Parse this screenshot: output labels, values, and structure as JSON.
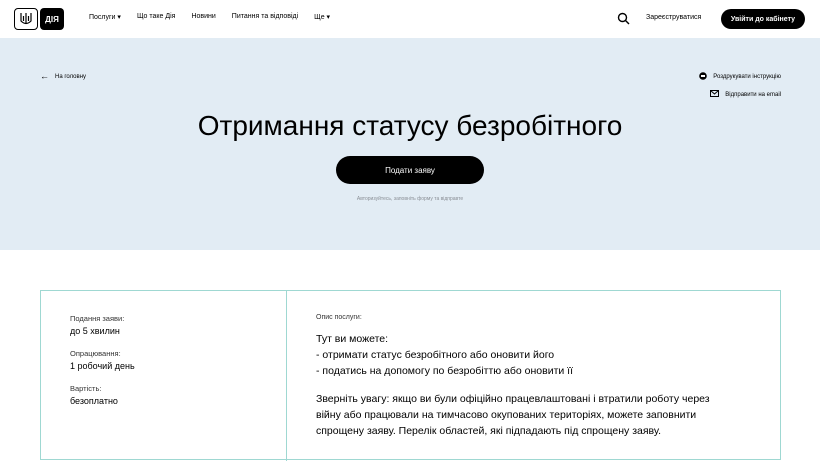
{
  "header": {
    "logo_text": "ДІЯ",
    "nav": [
      "Послуги ▾",
      "Що таке Дія",
      "Новини",
      "Питання та відповіді",
      "Ще ▾"
    ],
    "register": "Зареєструватися",
    "login": "Увійти до кабінету"
  },
  "hero": {
    "back": "На головну",
    "print": "Роздрукувати інструкцію",
    "email": "Відправити на email",
    "title": "Отримання статусу безробітного",
    "apply": "Подати заяву",
    "hint": "Авторизуйтесь, заповніть форму та відправте"
  },
  "card": {
    "items": [
      {
        "label": "Подання заяви:",
        "value": "до 5 хвилин"
      },
      {
        "label": "Опрацювання:",
        "value": "1 робочий день"
      },
      {
        "label": "Вартість:",
        "value": "безоплатно"
      }
    ],
    "desc_label": "Опис послуги:",
    "lines": [
      "Тут ви можете:",
      "- отримати статус безробітного або оновити його",
      "- податись на допомогу по безробіттю або оновити її"
    ],
    "notice": [
      "Зверніть увагу: якщо ви були офіційно працевлаштовані і втратили роботу через",
      "війну або працювали на тимчасово окупованих територіях, можете заповнити",
      "спрощену заяву. Перелік областей, які підпадають під спрощену заяву."
    ]
  }
}
